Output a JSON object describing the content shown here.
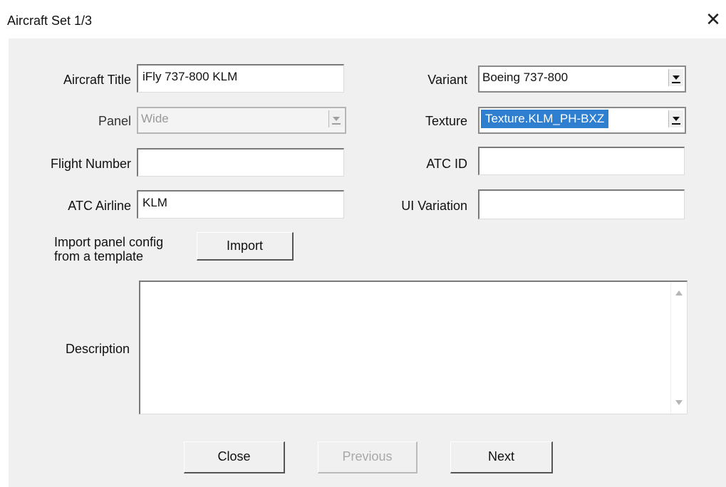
{
  "window": {
    "title": "Aircraft Set 1/3",
    "close_glyph": "✕"
  },
  "fields": {
    "aircraft_title": {
      "label": "Aircraft Title",
      "value": "iFly 737-800 KLM"
    },
    "panel": {
      "label": "Panel",
      "value": "Wide"
    },
    "flight_number": {
      "label": "Flight Number",
      "value": ""
    },
    "atc_airline": {
      "label": "ATC Airline",
      "value": "KLM"
    },
    "variant": {
      "label": "Variant",
      "value": "Boeing 737-800"
    },
    "texture": {
      "label": "Texture",
      "value": "Texture.KLM_PH-BXZ"
    },
    "atc_id": {
      "label": "ATC ID",
      "value": ""
    },
    "ui_variation": {
      "label": "UI Variation",
      "value": ""
    },
    "description": {
      "label": "Description",
      "value": ""
    }
  },
  "import": {
    "label_line1": "Import panel config",
    "label_line2": "from a template",
    "button": "Import"
  },
  "buttons": {
    "close": "Close",
    "previous": "Previous",
    "next": "Next"
  },
  "colors": {
    "selection": "#2f7fd0",
    "dialog_bg": "#f0f0f0"
  }
}
